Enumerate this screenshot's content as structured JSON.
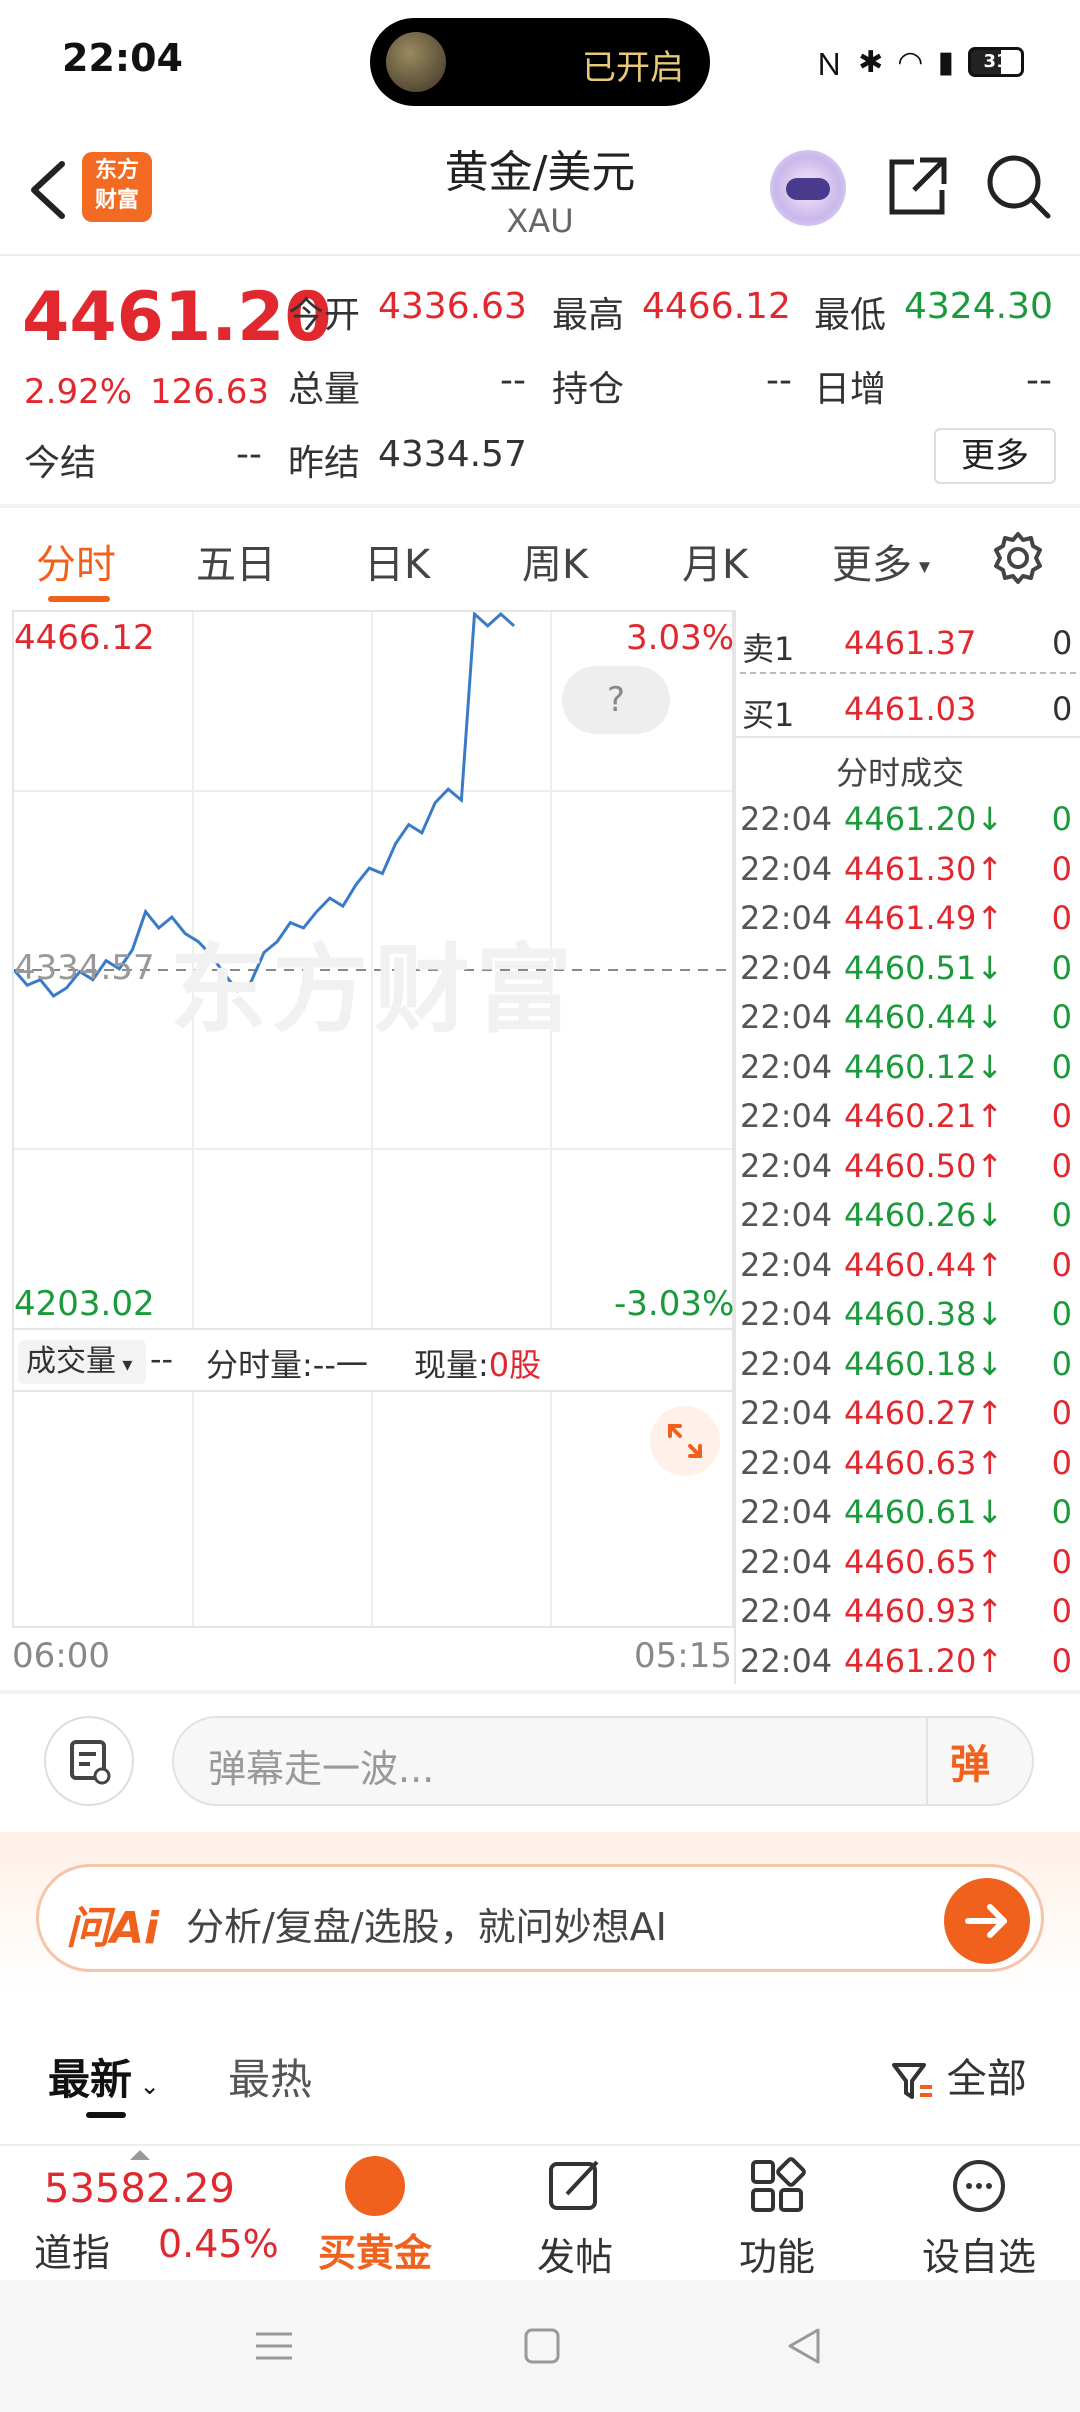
{
  "status": {
    "time": "22:04",
    "island_label": "已开启",
    "battery": "31"
  },
  "header": {
    "logo_top": "东方",
    "logo_bottom": "财富",
    "title": "黄金/美元",
    "subtitle": "XAU"
  },
  "quote": {
    "price": "4461.20",
    "pct": "2.92%",
    "change": "126.63",
    "open_label": "今开",
    "open": "4336.63",
    "high_label": "最高",
    "high": "4466.12",
    "low_label": "最低",
    "low": "4324.30",
    "volume_label": "总量",
    "volume": "--",
    "oi_label": "持仓",
    "oi": "--",
    "daily_inc_label": "日增",
    "daily_inc": "--",
    "settle_label": "今结",
    "settle": "--",
    "prev_settle_label": "昨结",
    "prev_settle": "4334.57",
    "more_label": "更多"
  },
  "tabs": [
    "分时",
    "五日",
    "日K",
    "周K",
    "月K",
    "更多"
  ],
  "chart": {
    "max_price": "4466.12",
    "max_pct": "3.03%",
    "min_price": "4203.02",
    "min_pct": "-3.03%",
    "prev_close": "4334.57",
    "watermark": "东方财富",
    "help": "?",
    "vol_select": "成交量",
    "vol_dash": "--",
    "time_vol_label": "分时量:--一",
    "cur_vol_label": "现量:",
    "cur_vol_value": "0股",
    "time_start": "06:00",
    "time_end": "05:15",
    "line_color": "#3a7bc8",
    "points": [
      4334.6,
      4329,
      4331,
      4325,
      4328,
      4334,
      4331,
      4338,
      4335,
      4342,
      4356,
      4350,
      4354,
      4348,
      4345,
      4340,
      4333,
      4327,
      4330,
      4341,
      4345,
      4352,
      4350,
      4356,
      4361,
      4358,
      4366,
      4372,
      4370,
      4381,
      4388,
      4385,
      4396,
      4401,
      4397,
      4468,
      4461,
      4466,
      4461
    ]
  },
  "orderbook": {
    "sell_label": "卖1",
    "sell_price": "4461.37",
    "sell_vol": "0",
    "buy_label": "买1",
    "buy_price": "4461.03",
    "buy_vol": "0",
    "trades_title": "分时成交"
  },
  "trades": [
    {
      "t": "22:04",
      "p": "4461.20↓",
      "v": "0",
      "d": "down"
    },
    {
      "t": "22:04",
      "p": "4461.30↑",
      "v": "0",
      "d": "up"
    },
    {
      "t": "22:04",
      "p": "4461.49↑",
      "v": "0",
      "d": "up"
    },
    {
      "t": "22:04",
      "p": "4460.51↓",
      "v": "0",
      "d": "down"
    },
    {
      "t": "22:04",
      "p": "4460.44↓",
      "v": "0",
      "d": "down"
    },
    {
      "t": "22:04",
      "p": "4460.12↓",
      "v": "0",
      "d": "down"
    },
    {
      "t": "22:04",
      "p": "4460.21↑",
      "v": "0",
      "d": "up"
    },
    {
      "t": "22:04",
      "p": "4460.50↑",
      "v": "0",
      "d": "up"
    },
    {
      "t": "22:04",
      "p": "4460.26↓",
      "v": "0",
      "d": "down"
    },
    {
      "t": "22:04",
      "p": "4460.44↑",
      "v": "0",
      "d": "up"
    },
    {
      "t": "22:04",
      "p": "4460.38↓",
      "v": "0",
      "d": "down"
    },
    {
      "t": "22:04",
      "p": "4460.18↓",
      "v": "0",
      "d": "down"
    },
    {
      "t": "22:04",
      "p": "4460.27↑",
      "v": "0",
      "d": "up"
    },
    {
      "t": "22:04",
      "p": "4460.63↑",
      "v": "0",
      "d": "up"
    },
    {
      "t": "22:04",
      "p": "4460.61↓",
      "v": "0",
      "d": "down"
    },
    {
      "t": "22:04",
      "p": "4460.65↑",
      "v": "0",
      "d": "up"
    },
    {
      "t": "22:04",
      "p": "4460.93↑",
      "v": "0",
      "d": "up"
    },
    {
      "t": "22:04",
      "p": "4461.20↑",
      "v": "0",
      "d": "up"
    }
  ],
  "danmaku": {
    "placeholder": "弹幕走一波...",
    "button": "弹"
  },
  "ai": {
    "logo": "问Ai",
    "text": "分析/复盘/选股，就问妙想AI"
  },
  "news": {
    "tab_latest": "最新",
    "tab_hot": "最热",
    "filter": "全部"
  },
  "toolbar": {
    "index_value": "53582.29",
    "index_name": "道指",
    "index_pct": "0.45%",
    "buy_gold": "买黄金",
    "post": "发帖",
    "functions": "功能",
    "watchlist": "设自选"
  }
}
